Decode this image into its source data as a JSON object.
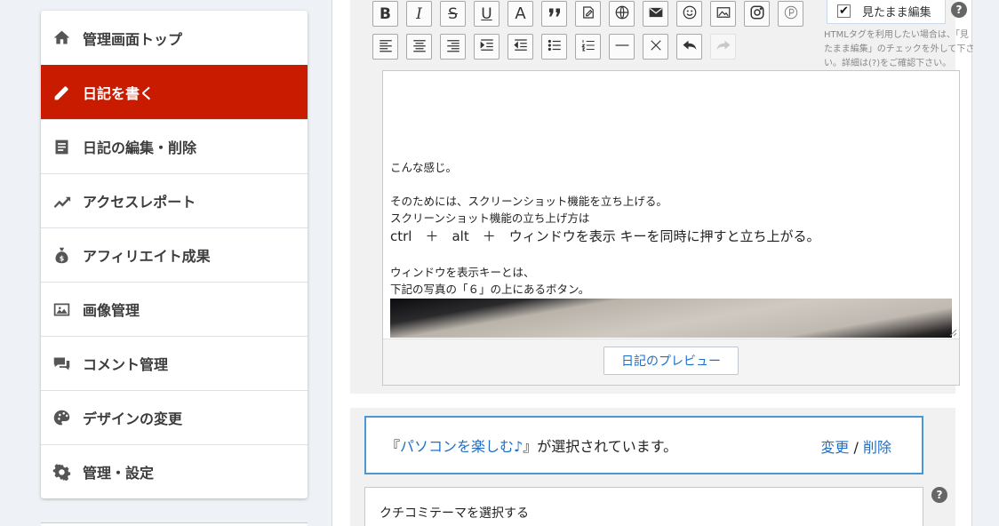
{
  "sidebar": {
    "items": [
      {
        "label": "管理画面トップ",
        "icon": "home-icon",
        "active": false
      },
      {
        "label": "日記を書く",
        "icon": "pencil-icon",
        "active": true
      },
      {
        "label": "日記の編集・削除",
        "icon": "document-icon",
        "active": false
      },
      {
        "label": "アクセスレポート",
        "icon": "trend-icon",
        "active": false
      },
      {
        "label": "アフィリエイト成果",
        "icon": "money-bag-icon",
        "active": false
      },
      {
        "label": "画像管理",
        "icon": "image-icon",
        "active": false
      },
      {
        "label": "コメント管理",
        "icon": "comments-icon",
        "active": false
      },
      {
        "label": "デザインの変更",
        "icon": "palette-icon",
        "active": false
      },
      {
        "label": "管理・設定",
        "icon": "gear-icon",
        "active": false
      }
    ],
    "active_color": "#c91b00"
  },
  "toolbar": {
    "row1": [
      "bold-icon",
      "italic-icon",
      "strikethrough-icon",
      "underline-icon",
      "font-size-icon",
      "quote-icon",
      "edit-note-icon",
      "globe-icon",
      "mail-icon",
      "smiley-icon",
      "picture-icon",
      "instagram-icon",
      "p-circle-icon"
    ],
    "row2": [
      "align-left-icon",
      "align-center-icon",
      "align-right-icon",
      "indent-icon",
      "outdent-icon",
      "bullet-list-icon",
      "numbered-list-icon",
      "horizontal-rule-icon",
      "clear-format-icon",
      "undo-icon",
      "redo-icon"
    ],
    "text": {
      "bold": "B",
      "italic": "I",
      "strike": "S",
      "underline": "U",
      "fontsize": "A"
    },
    "wysiwyg_label": "見たまま編集",
    "wysiwyg_checked": true,
    "wysiwyg_check_mark": "✔",
    "help_mark": "?",
    "note": "HTMLタグを利用したい場合は、「見たまま編集」のチェックを外して下さい。詳細は(?)をご確認下さい。"
  },
  "editor": {
    "lines": [
      "こんな感じ。",
      "",
      "そのためには、スクリーンショット機能を立ち上げる。",
      "スクリーンショット機能の立ち上げ方は",
      "ctrl　＋　alt　＋　ウィンドウを表示 キーを同時に押すと立ち上がる。",
      "",
      "ウィンドウを表示キーとは、",
      "下記の写真の「６」の上にあるボタン。"
    ],
    "preview_button": "日記のプレビュー"
  },
  "theme": {
    "open_quote": "『",
    "theme_name": "パソコンを楽しむ♪",
    "suffix": "』が選択されています。",
    "change_label": "変更",
    "separator": " / ",
    "delete_label": "削除",
    "kuchikomi_label": "クチコミテーマを選択する",
    "help_mark": "?"
  }
}
